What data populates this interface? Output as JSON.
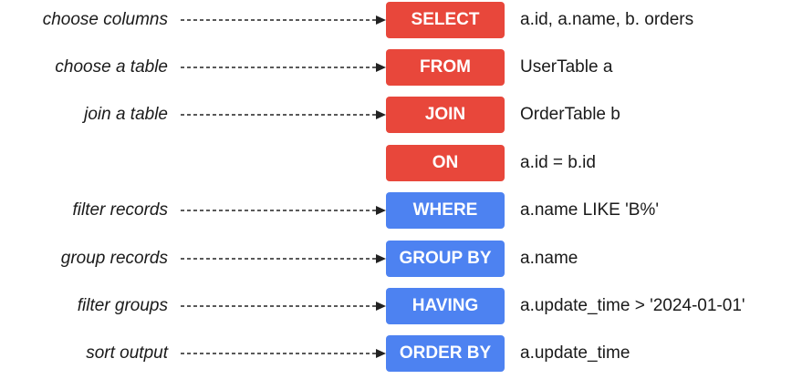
{
  "colors": {
    "clause_red": "#e8473b",
    "clause_blue": "#4d82f1",
    "text": "#1a1a1a",
    "arrow": "#222222"
  },
  "clauses": [
    {
      "description": "choose columns",
      "keyword": "SELECT",
      "expression": "a.id, a.name, b. orders",
      "color": "red",
      "has_arrow": true
    },
    {
      "description": "choose a table",
      "keyword": "FROM",
      "expression": "UserTable a",
      "color": "red",
      "has_arrow": true
    },
    {
      "description": "join a table",
      "keyword": "JOIN",
      "expression": "OrderTable b",
      "color": "red",
      "has_arrow": true
    },
    {
      "description": "",
      "keyword": "ON",
      "expression": "a.id = b.id",
      "color": "red",
      "has_arrow": false
    },
    {
      "description": "filter records",
      "keyword": "WHERE",
      "expression": "a.name LIKE 'B%'",
      "color": "blue",
      "has_arrow": true
    },
    {
      "description": "group records",
      "keyword": "GROUP BY",
      "expression": "a.name",
      "color": "blue",
      "has_arrow": true
    },
    {
      "description": "filter groups",
      "keyword": "HAVING",
      "expression": "a.update_time > '2024-01-01'",
      "color": "blue",
      "has_arrow": true
    },
    {
      "description": "sort output",
      "keyword": "ORDER BY",
      "expression": "a.update_time",
      "color": "blue",
      "has_arrow": true
    }
  ]
}
